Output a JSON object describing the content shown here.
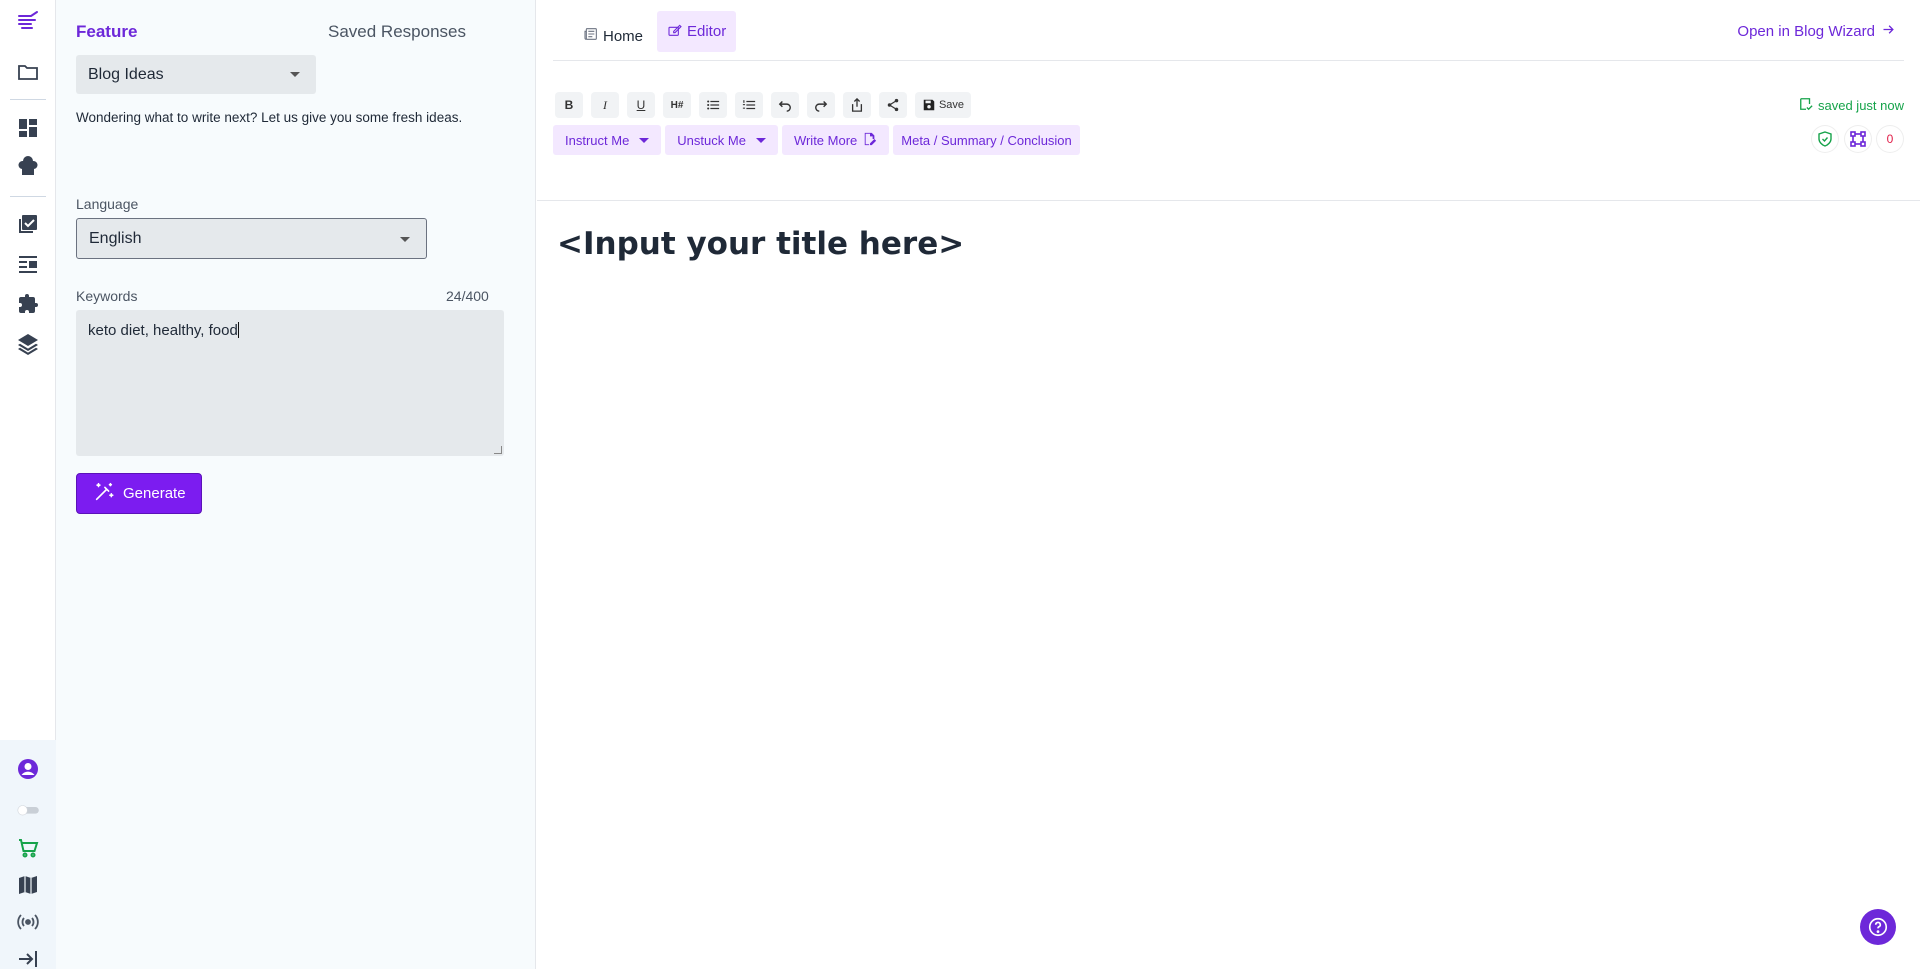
{
  "rail": {
    "icons": [
      "logo-icon",
      "folder-icon",
      "dashboard-icon",
      "chef-hat-icon",
      "checklist-icon",
      "article-icon",
      "puzzle-icon",
      "layers-icon",
      "account-icon",
      "toggle-icon",
      "cart-icon",
      "map-icon",
      "broadcast-icon",
      "collapse-icon"
    ]
  },
  "panel": {
    "tab_feature": "Feature",
    "tab_saved": "Saved Responses",
    "feature_select": "Blog Ideas",
    "description": "Wondering what to write next? Let us give you some fresh ideas.",
    "language_label": "Language",
    "language_select": "English",
    "keywords_label": "Keywords",
    "keywords_count": "24/400",
    "keywords_value": "keto diet, healthy, food",
    "generate_label": "Generate"
  },
  "main": {
    "nav_home": "Home",
    "nav_editor": "Editor",
    "open_wizard": "Open in Blog Wizard",
    "toolbar": {
      "bold": "B",
      "italic": "I",
      "underline": "U",
      "heading": "H#",
      "save": "Save"
    },
    "saved_status": "saved just now",
    "ai_buttons": {
      "instruct": "Instruct Me",
      "unstuck": "Unstuck Me",
      "write_more": "Write More",
      "meta": "Meta / Summary / Conclusion"
    },
    "issue_count": "0",
    "doc_title": "<Input your title here>"
  },
  "colors": {
    "accent": "#6d28d9",
    "generate": "#7c1cf0",
    "success": "#16a34a",
    "danger": "#e11d48"
  }
}
